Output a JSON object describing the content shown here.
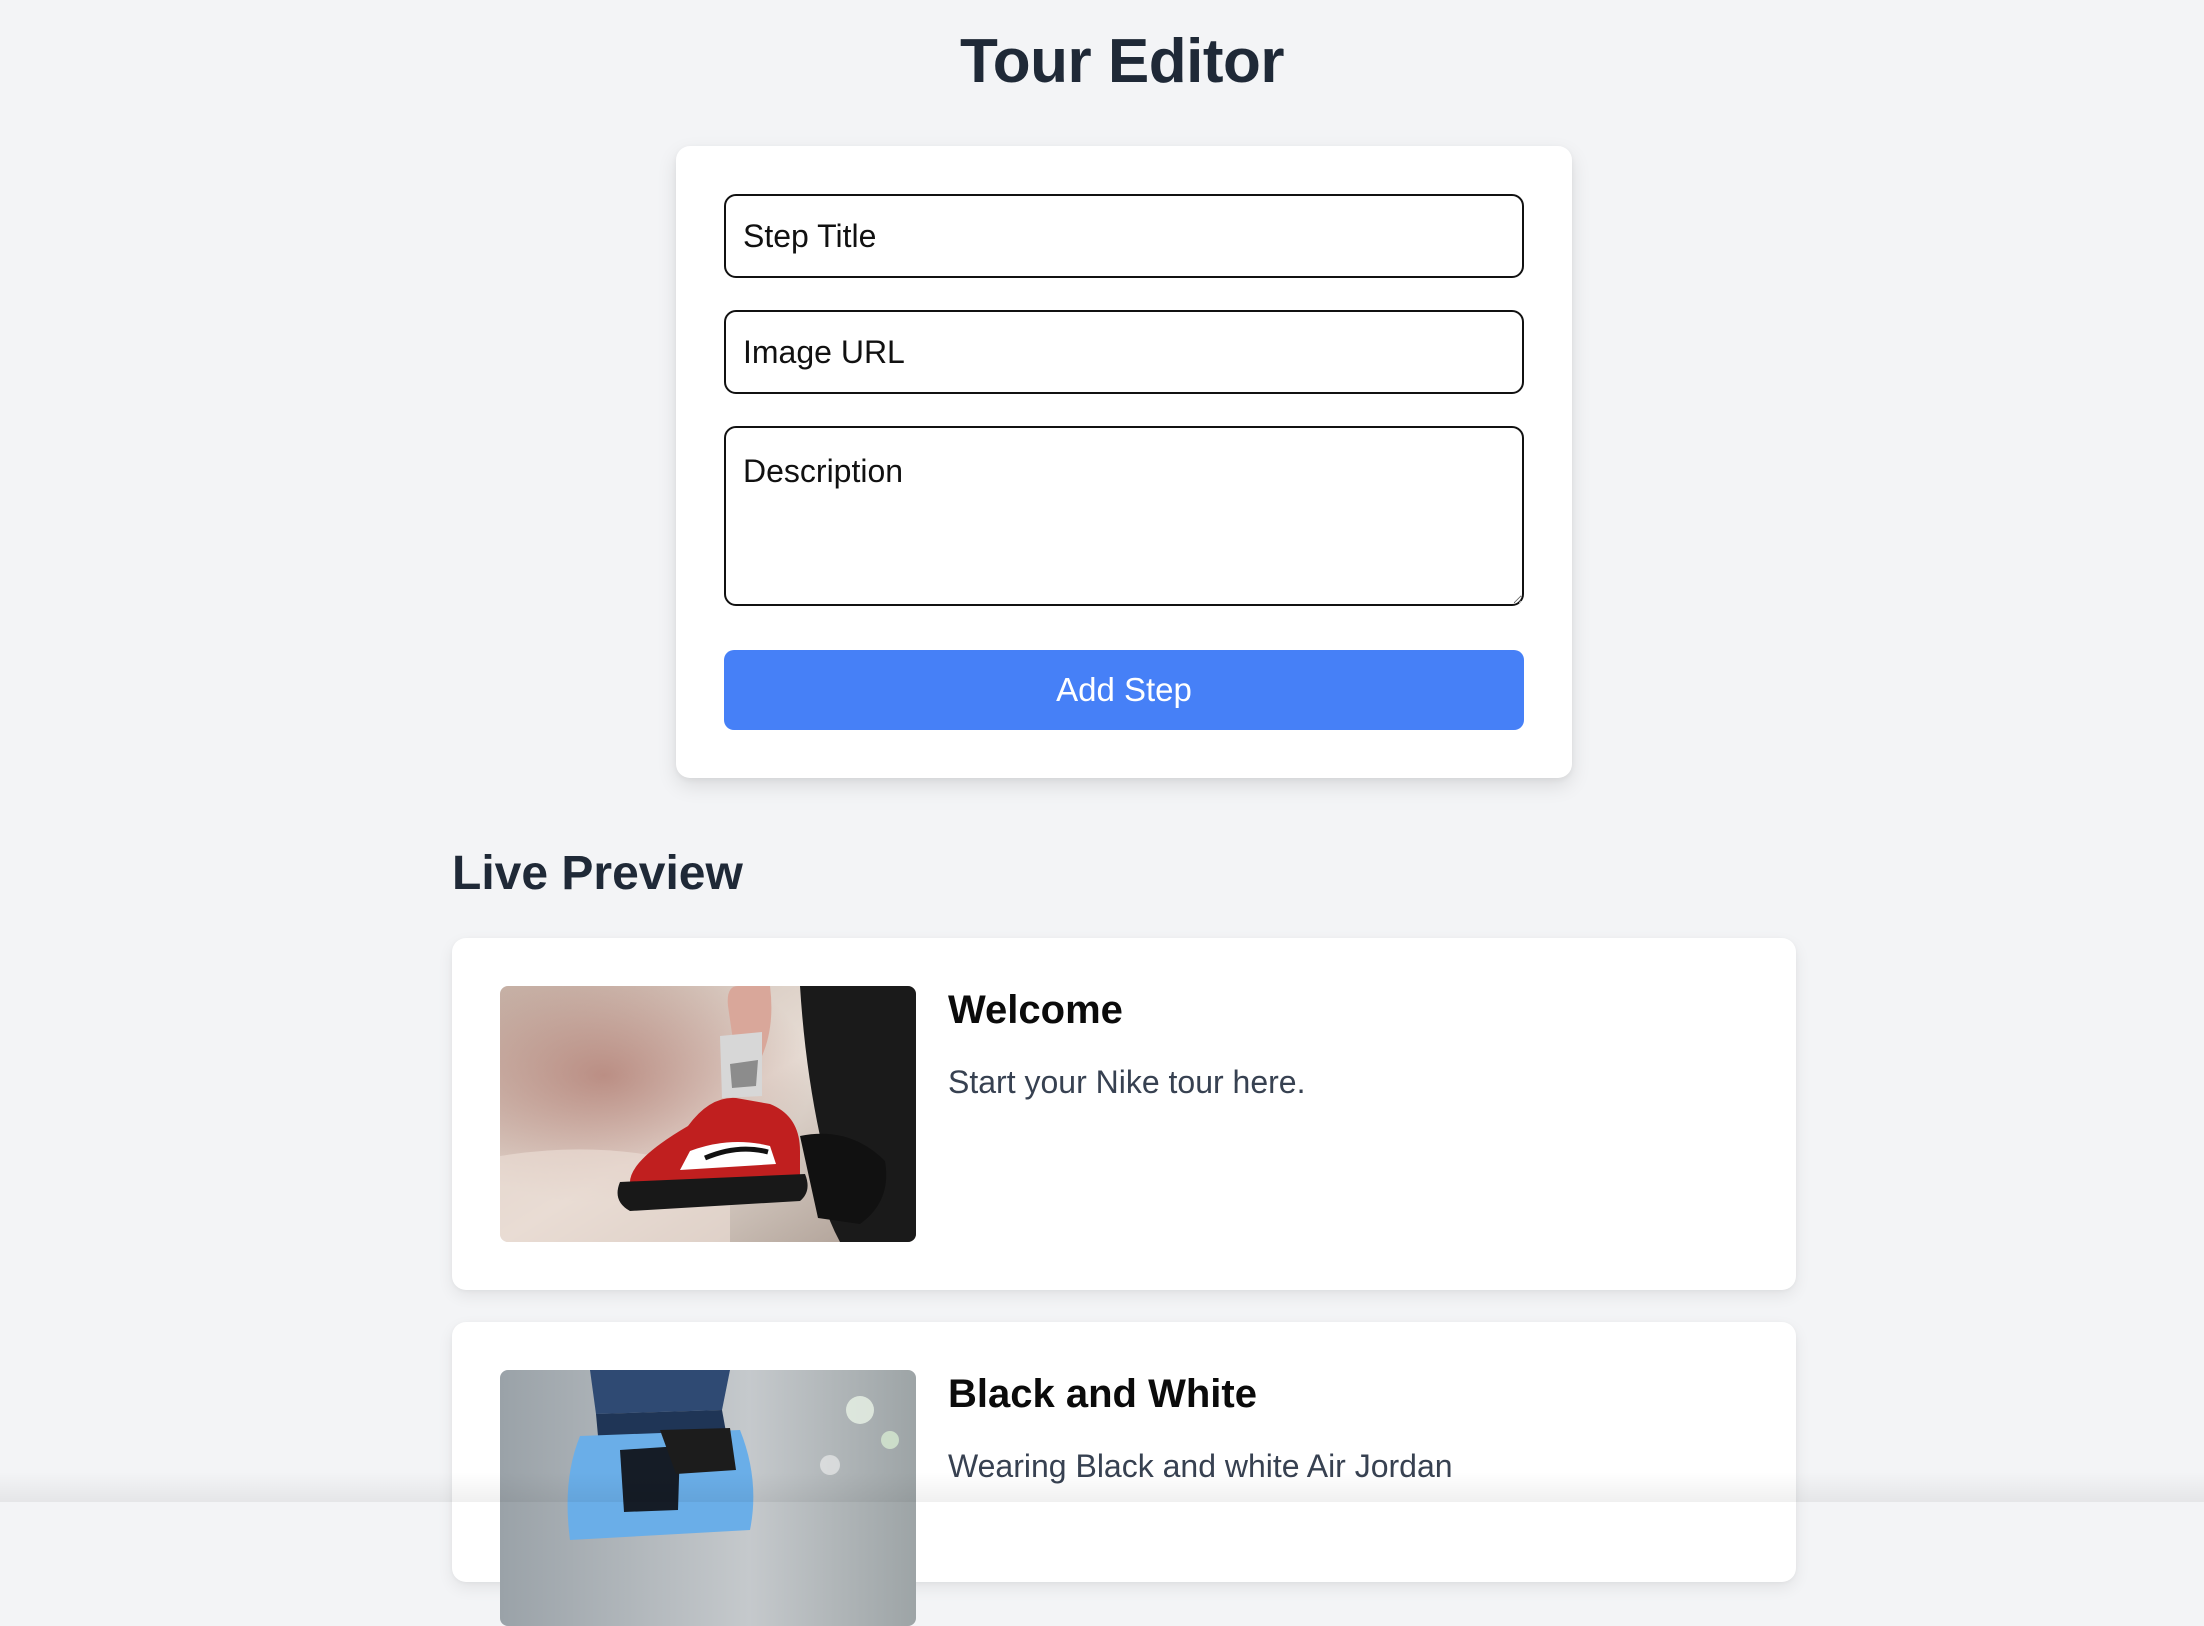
{
  "header": {
    "title": "Tour Editor"
  },
  "form": {
    "title_placeholder": "Step Title",
    "title_value": "",
    "image_placeholder": "Image URL",
    "image_value": "",
    "description_placeholder": "Description",
    "description_value": "",
    "add_button_label": "Add Step",
    "accent_color": "#4680f7"
  },
  "preview": {
    "heading": "Live Preview",
    "steps": [
      {
        "title": "Welcome",
        "description": "Start your Nike tour here."
      },
      {
        "title": "Black and White",
        "description": "Wearing Black and white Air Jordan"
      }
    ]
  }
}
